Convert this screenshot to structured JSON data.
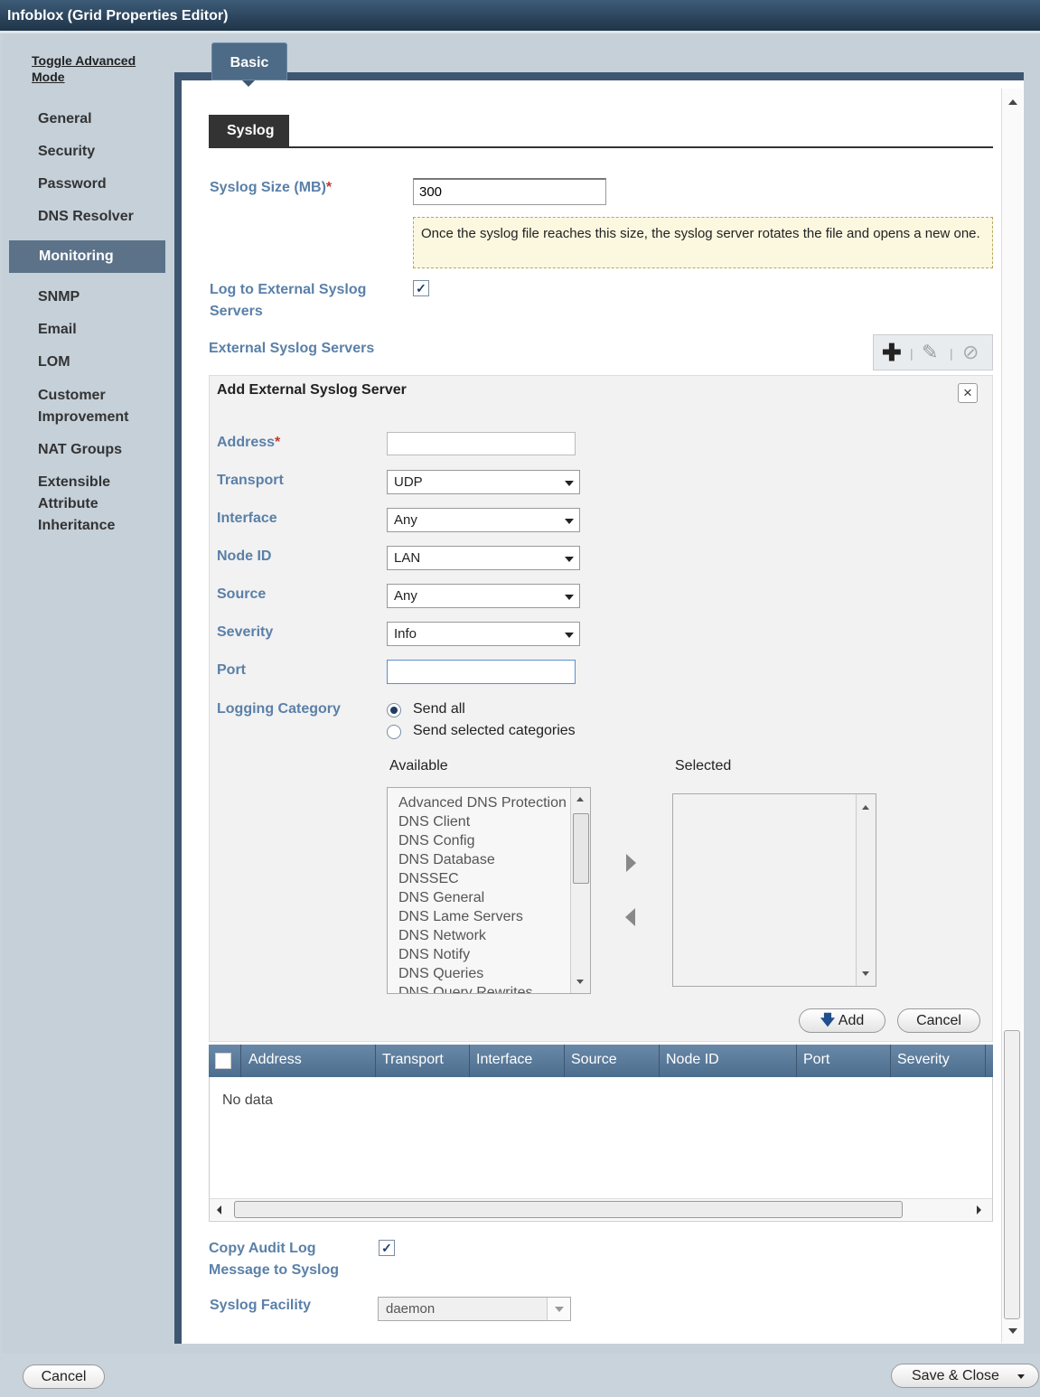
{
  "window": {
    "title": "Infoblox (Grid Properties Editor)"
  },
  "toggle_advanced": "Toggle Advanced Mode",
  "sidebar": {
    "items": [
      {
        "label": "General"
      },
      {
        "label": "Security"
      },
      {
        "label": "Password"
      },
      {
        "label": "DNS Resolver"
      },
      {
        "label": "Monitoring",
        "active": true
      },
      {
        "label": "SNMP"
      },
      {
        "label": "Email"
      },
      {
        "label": "LOM"
      },
      {
        "label": "Customer Improvement"
      },
      {
        "label": "NAT Groups"
      },
      {
        "label": "Extensible Attribute Inheritance"
      }
    ]
  },
  "tabs": {
    "basic": "Basic"
  },
  "section": {
    "syslog_tab": "Syslog"
  },
  "form": {
    "syslog_size_label": "Syslog Size (MB)",
    "required_mark": "*",
    "syslog_size_value": "300",
    "syslog_size_hint": "Once the syslog file reaches this size, the syslog server rotates the file and opens a new one.",
    "log_external_label": "Log to External Syslog Servers",
    "log_external_checked": true,
    "external_servers_label": "External Syslog Servers",
    "copy_audit_label": "Copy Audit Log Message to Syslog",
    "copy_audit_checked": true,
    "facility_label": "Syslog Facility",
    "facility_value": "daemon"
  },
  "toolbar": {
    "add_icon": "plus-icon",
    "edit_icon": "edit-icon",
    "delete_icon": "disabled-icon"
  },
  "add_server": {
    "title": "Add External Syslog Server",
    "address_label": "Address",
    "address_value": "",
    "transport_label": "Transport",
    "transport_value": "UDP",
    "interface_label": "Interface",
    "interface_value": "Any",
    "node_label": "Node ID",
    "node_value": "LAN",
    "source_label": "Source",
    "source_value": "Any",
    "severity_label": "Severity",
    "severity_value": "Info",
    "port_label": "Port",
    "port_value": "",
    "logging_label": "Logging Category",
    "send_all": "Send all",
    "send_selected": "Send selected categories",
    "available_label": "Available",
    "selected_label": "Selected",
    "available_items": [
      "Advanced DNS Protection",
      "DNS Client",
      "DNS Config",
      "DNS Database",
      "DNSSEC",
      "DNS General",
      "DNS Lame Servers",
      "DNS Network",
      "DNS Notify",
      "DNS Queries",
      "DNS Query Rewrites"
    ],
    "add_button": "Add",
    "cancel_button": "Cancel"
  },
  "grid": {
    "columns": [
      "Address",
      "Transport",
      "Interface",
      "Source",
      "Node ID",
      "Port",
      "Severity"
    ],
    "empty_text": "No data"
  },
  "footer": {
    "cancel": "Cancel",
    "save_close": "Save & Close"
  }
}
